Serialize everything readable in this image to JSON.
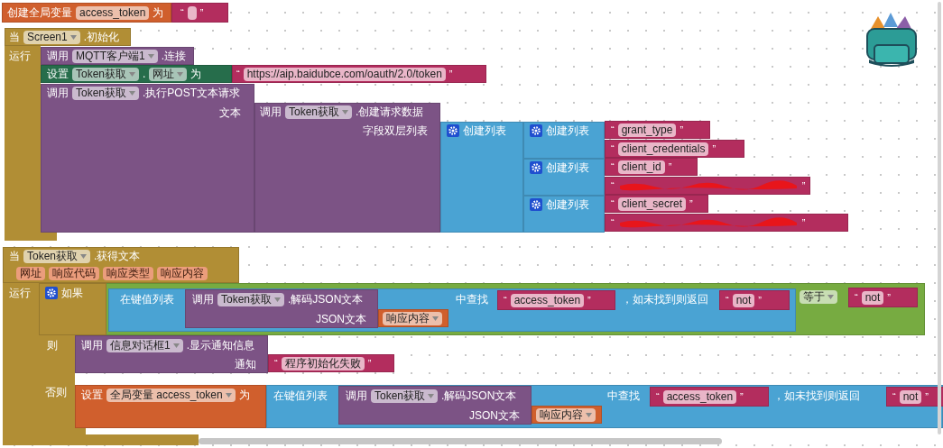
{
  "workspace": {
    "blocks": [
      {
        "kind": "variable",
        "parts": [
          {
            "kind": "label",
            "text": "创建全局变量"
          },
          {
            "kind": "chip",
            "text": "access_token"
          },
          {
            "kind": "label",
            "text": "为"
          }
        ]
      },
      {
        "kind": "text",
        "parts": [
          {
            "kind": "quote",
            "text": "“"
          },
          {
            "kind": "empty"
          },
          {
            "kind": "quote",
            "text": "”"
          }
        ]
      },
      {
        "kind": "event",
        "parts": [
          {
            "kind": "label",
            "text": "当"
          },
          {
            "kind": "dropdown",
            "text": "Screen1"
          },
          {
            "kind": "label",
            "text": ".初始化"
          }
        ],
        "sockets": [
          "运行"
        ]
      },
      {
        "kind": "procedure",
        "parts": [
          {
            "kind": "label",
            "text": "调用"
          },
          {
            "kind": "dropdown",
            "text": "MQTT客户端1"
          },
          {
            "kind": "label",
            "text": ".连接"
          }
        ]
      },
      {
        "kind": "setter",
        "parts": [
          {
            "kind": "label",
            "text": "设置"
          },
          {
            "kind": "dropdown",
            "text": "Token获取"
          },
          {
            "kind": "label",
            "text": "."
          },
          {
            "kind": "dropdown",
            "text": "网址"
          },
          {
            "kind": "label",
            "text": "为"
          }
        ]
      },
      {
        "kind": "text",
        "parts": [
          {
            "kind": "quote",
            "text": "“"
          },
          {
            "kind": "string",
            "text": "https://aip.baidubce.com/oauth/2.0/token"
          },
          {
            "kind": "quote",
            "text": "”"
          }
        ]
      },
      {
        "kind": "procedure",
        "parts": [
          {
            "kind": "label",
            "text": "调用"
          },
          {
            "kind": "dropdown",
            "text": "Token获取"
          },
          {
            "kind": "label",
            "text": ".执行POST文本请求"
          }
        ],
        "sockets": [
          "文本"
        ]
      },
      {
        "kind": "procedure",
        "parts": [
          {
            "kind": "label",
            "text": "调用"
          },
          {
            "kind": "dropdown",
            "text": "Token获取"
          },
          {
            "kind": "label",
            "text": ".创建请求数据"
          }
        ],
        "sockets": [
          "字段双层列表"
        ]
      },
      {
        "kind": "list",
        "parts": [
          {
            "kind": "gear"
          },
          {
            "kind": "label",
            "text": "创建列表"
          }
        ]
      },
      {
        "kind": "list",
        "parts": [
          {
            "kind": "gear"
          },
          {
            "kind": "label",
            "text": "创建列表"
          }
        ]
      },
      {
        "kind": "list",
        "parts": [
          {
            "kind": "gear"
          },
          {
            "kind": "label",
            "text": "创建列表"
          }
        ]
      },
      {
        "kind": "list",
        "parts": [
          {
            "kind": "gear"
          },
          {
            "kind": "label",
            "text": "创建列表"
          }
        ]
      },
      {
        "kind": "text",
        "parts": [
          {
            "kind": "quote",
            "text": "“"
          },
          {
            "kind": "string",
            "text": "grant_type"
          },
          {
            "kind": "quote",
            "text": "”"
          }
        ]
      },
      {
        "kind": "text",
        "parts": [
          {
            "kind": "quote",
            "text": "“"
          },
          {
            "kind": "string",
            "text": "client_credentials"
          },
          {
            "kind": "quote",
            "text": "”"
          }
        ]
      },
      {
        "kind": "text",
        "parts": [
          {
            "kind": "quote",
            "text": "“"
          },
          {
            "kind": "string",
            "text": "client_id"
          },
          {
            "kind": "quote",
            "text": "”"
          }
        ]
      },
      {
        "kind": "text",
        "parts": [
          {
            "kind": "quote",
            "text": "“"
          },
          {
            "kind": "redacted"
          },
          {
            "kind": "quote",
            "text": "”"
          }
        ]
      },
      {
        "kind": "text",
        "parts": [
          {
            "kind": "quote",
            "text": "“"
          },
          {
            "kind": "string",
            "text": "client_secret"
          },
          {
            "kind": "quote",
            "text": "”"
          }
        ]
      },
      {
        "kind": "text",
        "parts": [
          {
            "kind": "quote",
            "text": "“"
          },
          {
            "kind": "redacted"
          },
          {
            "kind": "quote",
            "text": "”"
          }
        ]
      },
      {
        "kind": "event",
        "parts": [
          {
            "kind": "label",
            "text": "当"
          },
          {
            "kind": "dropdown",
            "text": "Token获取"
          },
          {
            "kind": "label",
            "text": ".获得文本"
          }
        ],
        "params": [
          "网址",
          "响应代码",
          "响应类型",
          "响应内容"
        ],
        "sockets": [
          "运行"
        ]
      },
      {
        "kind": "control",
        "parts": [
          {
            "kind": "gear"
          },
          {
            "kind": "label",
            "text": "如果"
          }
        ],
        "sockets": [
          "则",
          "否则"
        ]
      },
      {
        "kind": "dict",
        "parts": [
          {
            "kind": "label",
            "text": "在键值列表"
          }
        ],
        "sockets": [
          "中查找",
          "，如未找到则返回"
        ]
      },
      {
        "kind": "procedure",
        "parts": [
          {
            "kind": "label",
            "text": "调用"
          },
          {
            "kind": "dropdown",
            "text": "Token获取"
          },
          {
            "kind": "label",
            "text": ".解码JSON文本"
          }
        ],
        "sockets": [
          "JSON文本"
        ]
      },
      {
        "kind": "variable",
        "parts": [
          {
            "kind": "dropdown",
            "text": "响应内容"
          }
        ]
      },
      {
        "kind": "text",
        "parts": [
          {
            "kind": "quote",
            "text": "“"
          },
          {
            "kind": "string",
            "text": "access_token"
          },
          {
            "kind": "quote",
            "text": "”"
          }
        ]
      },
      {
        "kind": "text",
        "parts": [
          {
            "kind": "quote",
            "text": "“"
          },
          {
            "kind": "string",
            "text": "not"
          },
          {
            "kind": "quote",
            "text": "”"
          }
        ]
      },
      {
        "kind": "logic",
        "parts": [
          {
            "kind": "dropdown",
            "text": "等于"
          }
        ]
      },
      {
        "kind": "text",
        "parts": [
          {
            "kind": "quote",
            "text": "“"
          },
          {
            "kind": "string",
            "text": "not"
          },
          {
            "kind": "quote",
            "text": "”"
          }
        ]
      },
      {
        "kind": "procedure",
        "parts": [
          {
            "kind": "label",
            "text": "调用"
          },
          {
            "kind": "dropdown",
            "text": "信息对话框1"
          },
          {
            "kind": "label",
            "text": ".显示通知信息"
          }
        ],
        "sockets": [
          "通知"
        ]
      },
      {
        "kind": "text",
        "parts": [
          {
            "kind": "quote",
            "text": "“"
          },
          {
            "kind": "string",
            "text": "程序初始化失败"
          },
          {
            "kind": "quote",
            "text": "”"
          }
        ]
      },
      {
        "kind": "variable",
        "parts": [
          {
            "kind": "label",
            "text": "设置"
          },
          {
            "kind": "dropdown",
            "text": "全局变量 access_token"
          },
          {
            "kind": "label",
            "text": "为"
          }
        ]
      },
      {
        "kind": "dict",
        "parts": [
          {
            "kind": "label",
            "text": "在键值列表"
          }
        ],
        "sockets": [
          "中查找",
          "，如未找到则返回"
        ]
      },
      {
        "kind": "procedure",
        "parts": [
          {
            "kind": "label",
            "text": "调用"
          },
          {
            "kind": "dropdown",
            "text": "Token获取"
          },
          {
            "kind": "label",
            "text": ".解码JSON文本"
          }
        ],
        "sockets": [
          "JSON文本"
        ]
      },
      {
        "kind": "variable",
        "parts": [
          {
            "kind": "dropdown",
            "text": "响应内容"
          }
        ]
      },
      {
        "kind": "text",
        "parts": [
          {
            "kind": "quote",
            "text": "“"
          },
          {
            "kind": "string",
            "text": "access_token"
          },
          {
            "kind": "quote",
            "text": "”"
          }
        ]
      },
      {
        "kind": "text",
        "parts": [
          {
            "kind": "quote",
            "text": "“"
          },
          {
            "kind": "string",
            "text": "not"
          },
          {
            "kind": "quote",
            "text": "”"
          }
        ]
      }
    ]
  }
}
